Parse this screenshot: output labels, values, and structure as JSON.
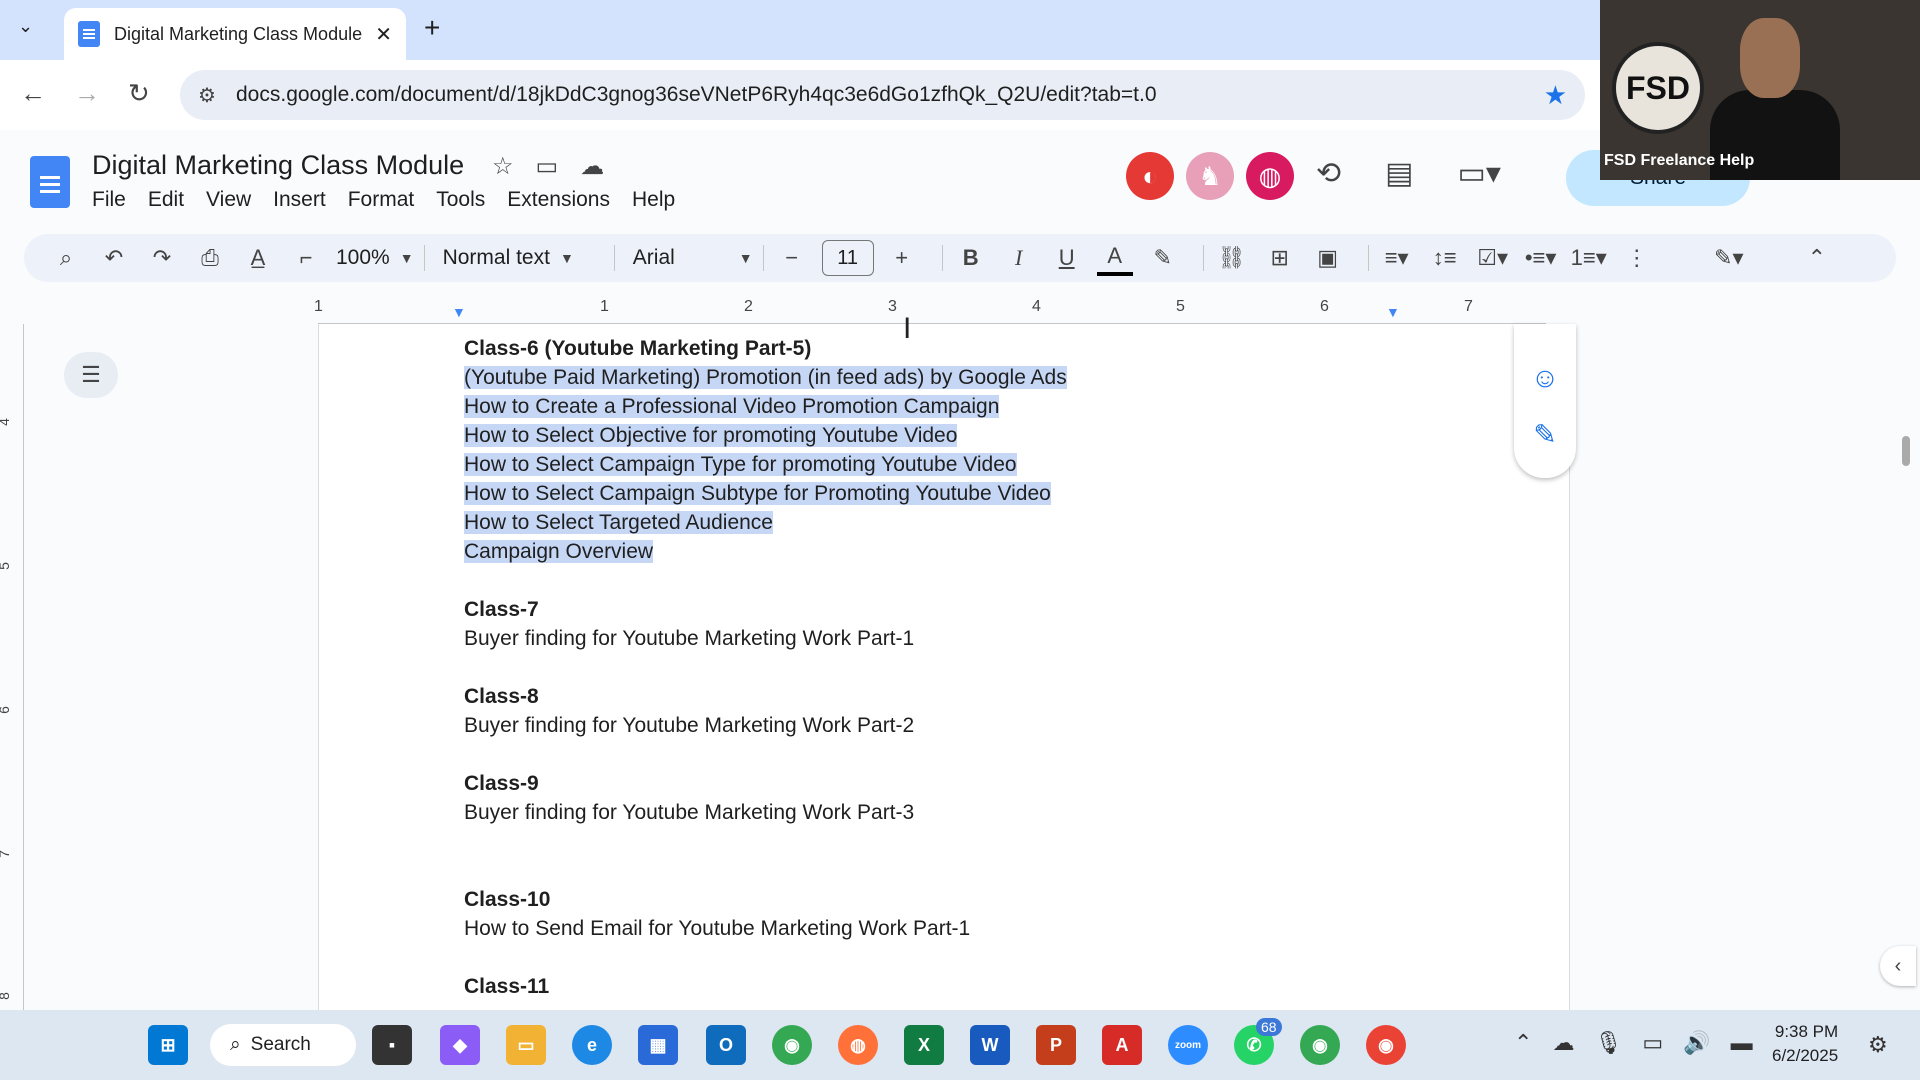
{
  "browser": {
    "tab_title": "Digital Marketing Class Module",
    "url": "docs.google.com/document/d/18jkDdC3gnog36seVNetP6Ryh4qc3e6dGo1zfhQk_Q2U/edit?tab=t.0"
  },
  "doc": {
    "title": "Digital Marketing Class Module",
    "menus": [
      "File",
      "Edit",
      "View",
      "Insert",
      "Format",
      "Tools",
      "Extensions",
      "Help"
    ],
    "share_label": "Share"
  },
  "toolbar": {
    "zoom": "100%",
    "style": "Normal text",
    "font": "Arial",
    "size": "11"
  },
  "ruler": {
    "numbers": [
      "1",
      "1",
      "2",
      "3",
      "4",
      "5",
      "6",
      "7"
    ],
    "vertical": [
      "4",
      "5",
      "6",
      "7",
      "8"
    ]
  },
  "content": {
    "class6_title": "Class-6 (Youtube Marketing Part-5)",
    "class6_items": [
      "(Youtube Paid Marketing) Promotion (in feed ads)  by Google Ads",
      "How to Create a Professional Video Promotion Campaign",
      "How to Select Objective for promoting Youtube Video",
      "How to Select Campaign Type for promoting Youtube Video",
      "How to Select Campaign Subtype for Promoting Youtube Video",
      "How to Select Targeted Audience",
      "Campaign Overview"
    ],
    "class7_title": "Class-7",
    "class7_text": "Buyer finding for Youtube Marketing Work Part-1",
    "class8_title": "Class-8",
    "class8_text": "Buyer finding for Youtube Marketing Work Part-2",
    "class9_title": "Class-9",
    "class9_text": "Buyer finding for Youtube Marketing Work Part-3",
    "class10_title": "Class-10",
    "class10_text": "How to Send Email for Youtube Marketing Work Part-1",
    "class11_title": "Class-11"
  },
  "webcam": {
    "label": "FSD Freelance Help",
    "logo": "FSD"
  },
  "taskbar": {
    "search": "Search",
    "badge": "68",
    "time": "9:38 PM",
    "date": "6/2/2025"
  },
  "colors": {
    "accent": "#1a73e8",
    "selection": "#c6d7f5",
    "share_bg": "#c2e7ff",
    "av1": "#e53935",
    "av2": "#e8a0b8",
    "av3": "#d81b60"
  }
}
